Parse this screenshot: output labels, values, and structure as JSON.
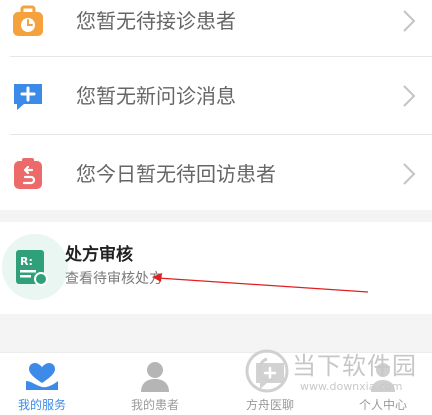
{
  "list": {
    "items": [
      {
        "label": "您暂无待接诊患者",
        "icon": "clock-briefcase-icon",
        "icon_color": "#f5a13c"
      },
      {
        "label": "您暂无新问诊消息",
        "icon": "chat-plus-icon",
        "icon_color": "#3d8be8"
      },
      {
        "label": "您今日暂无待回访患者",
        "icon": "clipboard-return-icon",
        "icon_color": "#ec6a6a"
      }
    ]
  },
  "prescription_card": {
    "title": "处方审核",
    "subtitle": "查看待审核处方",
    "icon": "prescription-icon",
    "icon_color": "#2fa07a"
  },
  "tabbar": {
    "tabs": [
      {
        "label": "我的服务",
        "icon": "heart-hand-icon",
        "active": true
      },
      {
        "label": "我的患者",
        "icon": "person-icon",
        "active": false
      },
      {
        "label": "方舟医聊",
        "icon": "chat-icon",
        "active": false
      },
      {
        "label": "个人中心",
        "icon": "profile-icon",
        "active": false
      }
    ]
  },
  "watermark": {
    "name": "当下软件园",
    "url": "www.downxia.com"
  },
  "colors": {
    "accent": "#3d8be8",
    "annotation_arrow": "#e02020"
  }
}
